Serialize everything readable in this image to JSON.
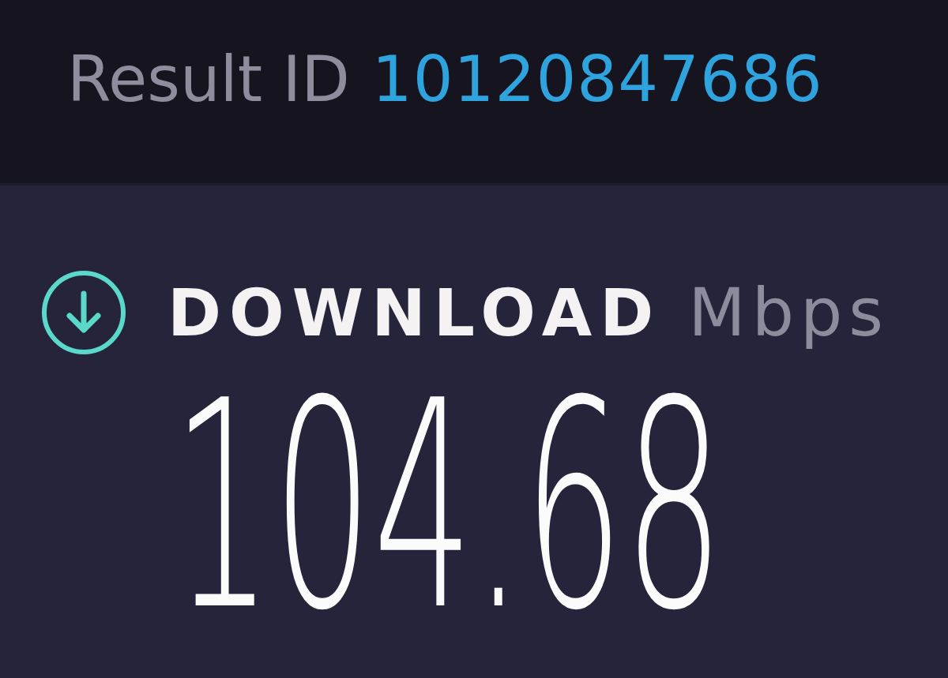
{
  "result": {
    "label": "Result ID",
    "id": "10120847686"
  },
  "metric": {
    "kind": "download",
    "label": "DOWNLOAD",
    "unit": "Mbps",
    "value": "104.68"
  }
}
